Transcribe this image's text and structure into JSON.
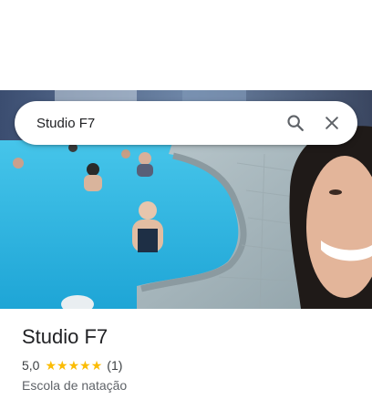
{
  "search": {
    "query": "Studio F7"
  },
  "icons": {
    "search": "search-icon",
    "close": "close-icon",
    "star": "star-icon"
  },
  "place": {
    "title": "Studio F7",
    "rating": "5,0",
    "stars_filled": 5,
    "stars_total": 5,
    "review_count": "(1)",
    "category": "Escola de natação"
  },
  "colors": {
    "star": "#fbbc04",
    "icon": "#5f6368",
    "water": "#2fb2dc",
    "text_primary": "#202124",
    "text_secondary": "#5f6368"
  }
}
